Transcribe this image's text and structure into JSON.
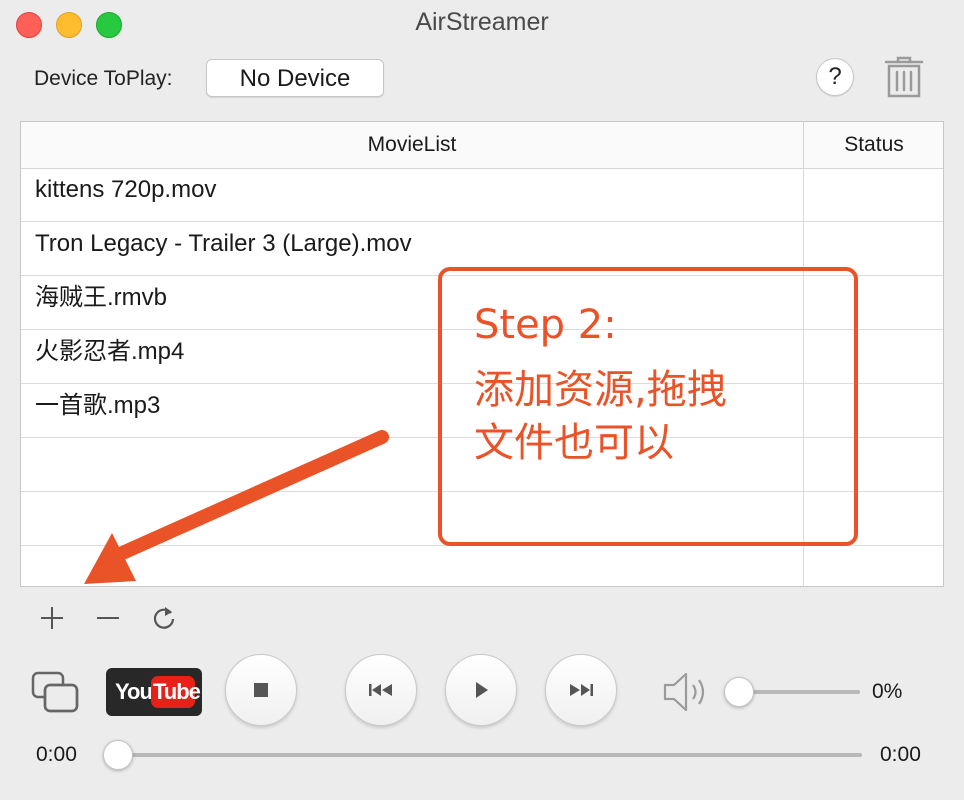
{
  "window": {
    "title": "AirStreamer"
  },
  "toolbar": {
    "device_label": "Device ToPlay:",
    "device_button": "No Device",
    "help_label": "?"
  },
  "table": {
    "columns": [
      "MovieList",
      "Status"
    ],
    "rows": [
      {
        "name": "kittens 720p.mov",
        "status": ""
      },
      {
        "name": "Tron Legacy - Trailer 3 (Large).mov",
        "status": ""
      },
      {
        "name": "海贼王.rmvb",
        "status": ""
      },
      {
        "name": "火影忍者.mp4",
        "status": ""
      },
      {
        "name": "一首歌.mp3",
        "status": ""
      },
      {
        "name": "",
        "status": ""
      },
      {
        "name": "",
        "status": ""
      },
      {
        "name": "",
        "status": ""
      }
    ]
  },
  "list_controls": {
    "add": "+",
    "remove": "−",
    "refresh": "refresh-icon"
  },
  "player": {
    "youtube_you": "You",
    "youtube_tube": "Tube",
    "volume_percent": "0%",
    "volume_fraction": 0,
    "time_elapsed": "0:00",
    "time_total": "0:00",
    "progress_fraction": 0
  },
  "annotation": {
    "line1": "Step 2:",
    "line2": "添加资源,拖拽",
    "line3": "文件也可以",
    "color": "#ea5227"
  },
  "colors": {
    "accent": "#ea5227",
    "close": "#fe5f57",
    "minimize": "#febc2e",
    "zoom": "#28c840"
  }
}
